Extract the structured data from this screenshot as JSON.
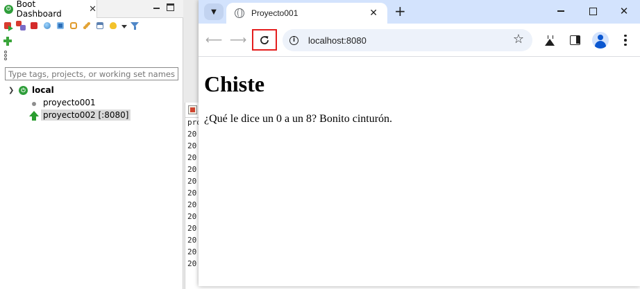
{
  "eclipse": {
    "view_title": "Boot Dashboard",
    "view_close": "✕",
    "filter_placeholder": "Type tags, projects, or working set names to m",
    "tree": {
      "root_label": "local",
      "children": [
        {
          "label": "proyecto001",
          "state": "stopped"
        },
        {
          "label": "proyecto002 [:8080]",
          "state": "running",
          "selected": true
        }
      ]
    },
    "console_lines": [
      "pro",
      "20",
      "20",
      "20",
      "20",
      "20",
      "20",
      "20",
      "20",
      "20",
      "20",
      "20",
      "20"
    ]
  },
  "chrome": {
    "tab": {
      "title": "Proyecto001",
      "close": "✕"
    },
    "new_tab": "+",
    "window_close": "✕",
    "url": "localhost:8080",
    "info_glyph": "i",
    "accent_highlight": "#e41e1e",
    "tabstrip_color": "#d3e3fd"
  },
  "page": {
    "heading": "Chiste",
    "paragraph": "¿Qué le dice un 0 a un 8? Bonito cinturón."
  }
}
